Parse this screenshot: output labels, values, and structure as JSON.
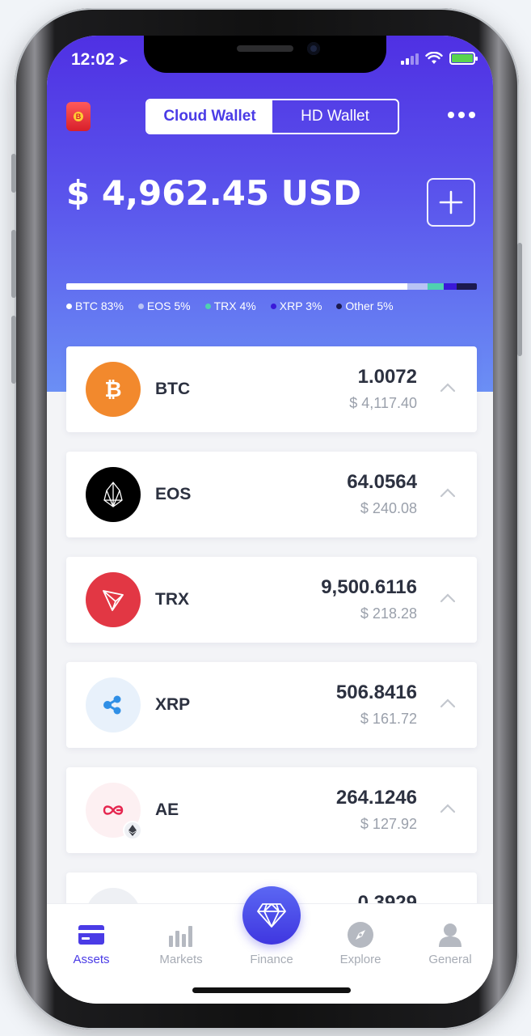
{
  "status": {
    "time": "12:02"
  },
  "header": {
    "tabs": [
      {
        "label": "Cloud Wallet",
        "active": true
      },
      {
        "label": "HD Wallet",
        "active": false
      }
    ],
    "total_balance": "$ 4,962.45 USD"
  },
  "allocation": [
    {
      "label": "BTC 83%",
      "percent": 83,
      "color": "#ffffff"
    },
    {
      "label": "EOS 5%",
      "percent": 5,
      "color": "#b8c3f5"
    },
    {
      "label": "TRX 4%",
      "percent": 4,
      "color": "#4fd1b0"
    },
    {
      "label": "XRP 3%",
      "percent": 3,
      "color": "#3a18d9"
    },
    {
      "label": "Other 5%",
      "percent": 5,
      "color": "#1c1a4f"
    }
  ],
  "assets": [
    {
      "symbol": "BTC",
      "amount": "1.0072",
      "value": "$ 4,117.40",
      "icon": "bitcoin-icon",
      "color": "#f2892d"
    },
    {
      "symbol": "EOS",
      "amount": "64.0564",
      "value": "$ 240.08",
      "icon": "eos-icon",
      "color": "#000000"
    },
    {
      "symbol": "TRX",
      "amount": "9,500.6116",
      "value": "$ 218.28",
      "icon": "tron-icon",
      "color": "#e23744"
    },
    {
      "symbol": "XRP",
      "amount": "506.8416",
      "value": "$ 161.72",
      "icon": "ripple-icon",
      "color": "#2f8fe6"
    },
    {
      "symbol": "AE",
      "amount": "264.1246",
      "value": "$ 127.92",
      "icon": "aeternity-icon",
      "color": "#e5264f"
    },
    {
      "symbol": "",
      "amount": "0.3929",
      "value": "",
      "icon": "ethereum-icon",
      "color": "#6b6f78"
    }
  ],
  "tabbar": {
    "assets": "Assets",
    "markets": "Markets",
    "finance": "Finance",
    "explore": "Explore",
    "general": "General"
  },
  "colors": {
    "accent": "#4a3be6",
    "header_top": "#4f30e3",
    "header_bottom": "#6b8ff5"
  }
}
